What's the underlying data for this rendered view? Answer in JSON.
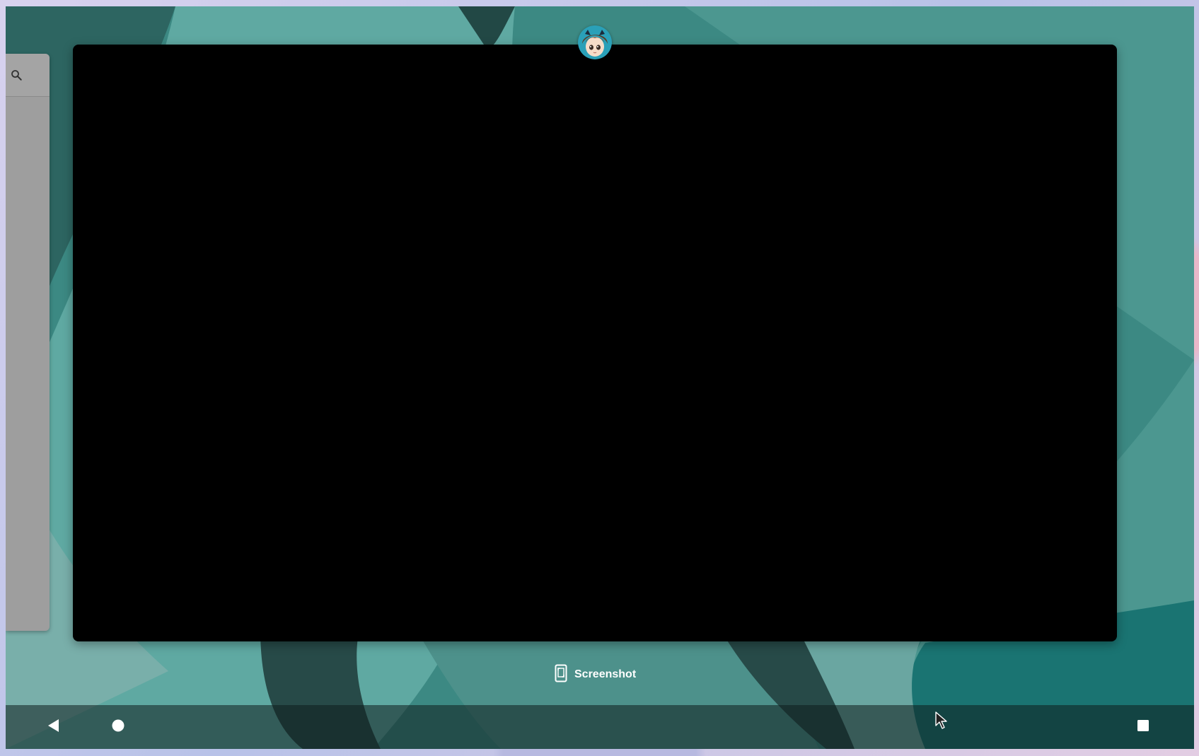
{
  "overview": {
    "screenshot_label": "Screenshot"
  },
  "icons": {
    "search": "search-icon",
    "app_avatar": "app-avatar-icon",
    "screenshot": "phone-screenshot-icon",
    "back": "back-triangle-icon",
    "home": "home-circle-icon",
    "recents": "recents-square-icon"
  },
  "colors": {
    "wallpaper_teal": "#3f8f8a",
    "card_background": "#000000",
    "side_panel": "#9e9e9e",
    "nav_bar": "#1e3434"
  }
}
